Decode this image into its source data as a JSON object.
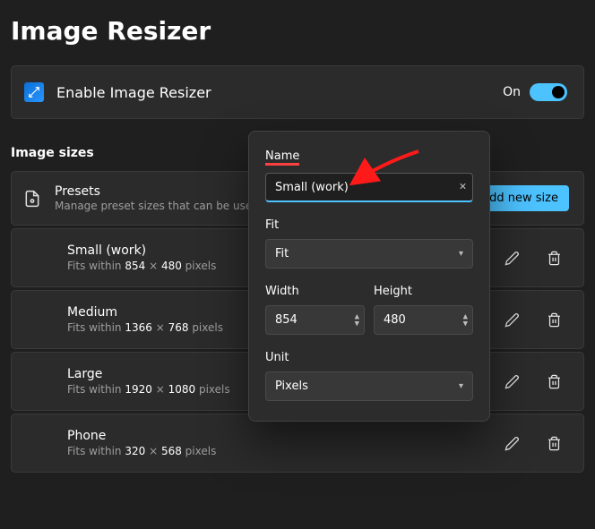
{
  "title": "Image Resizer",
  "enable": {
    "label": "Enable Image Resizer",
    "state_text": "On",
    "on": true
  },
  "section_label": "Image sizes",
  "presets": {
    "title": "Presets",
    "subtitle": "Manage preset sizes that can be used i",
    "add_label": "Add new size"
  },
  "sizes": [
    {
      "name": "Small (work)",
      "prefix": "Fits within",
      "w": "854",
      "h": "480",
      "unit": "pixels"
    },
    {
      "name": "Medium",
      "prefix": "Fits within",
      "w": "1366",
      "h": "768",
      "unit": "pixels"
    },
    {
      "name": "Large",
      "prefix": "Fits within",
      "w": "1920",
      "h": "1080",
      "unit": "pixels"
    },
    {
      "name": "Phone",
      "prefix": "Fits within",
      "w": "320",
      "h": "568",
      "unit": "pixels"
    }
  ],
  "popup": {
    "name_label": "Name",
    "name_value": "Small (work)",
    "fit_label": "Fit",
    "fit_value": "Fit",
    "width_label": "Width",
    "width_value": "854",
    "height_label": "Height",
    "height_value": "480",
    "unit_label": "Unit",
    "unit_value": "Pixels"
  }
}
